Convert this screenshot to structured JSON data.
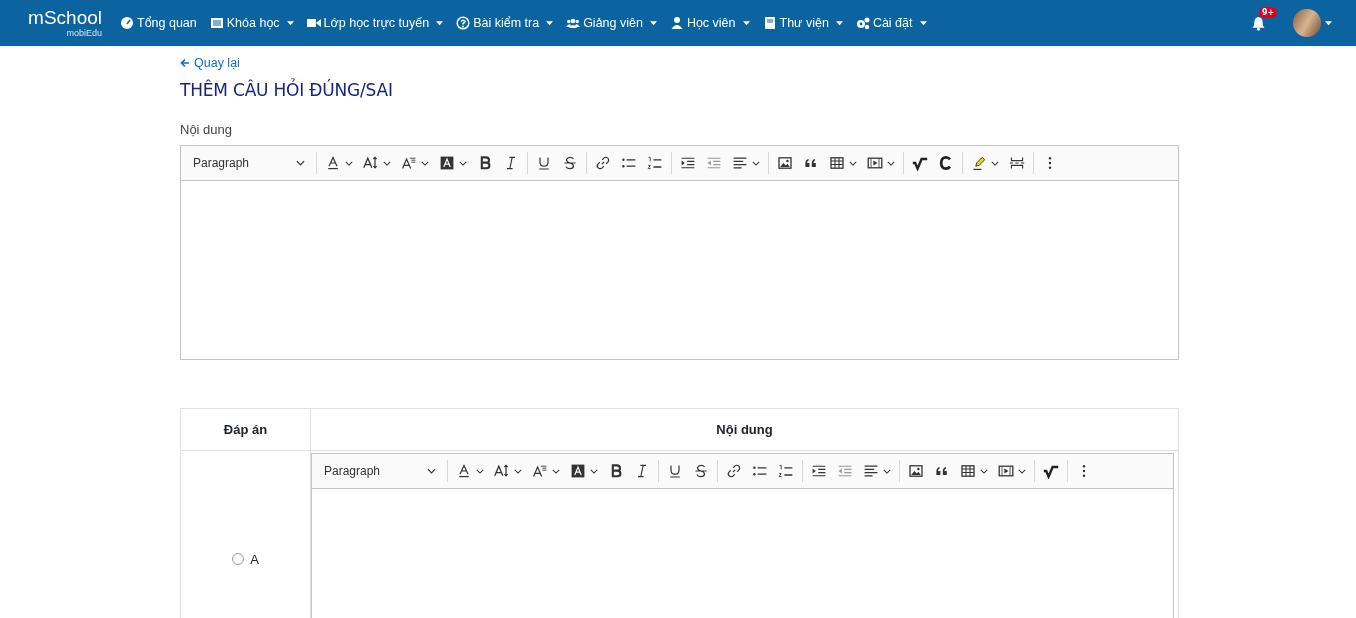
{
  "navbar": {
    "logo": {
      "main": "mSchool",
      "sub": "mobiEdu"
    },
    "items": [
      {
        "label": "Tổng quan",
        "dropdown": false
      },
      {
        "label": "Khóa học",
        "dropdown": true
      },
      {
        "label": "Lớp học trực tuyến",
        "dropdown": true
      },
      {
        "label": "Bài kiểm tra",
        "dropdown": true
      },
      {
        "label": "Giảng viên",
        "dropdown": true
      },
      {
        "label": "Học viên",
        "dropdown": true
      },
      {
        "label": "Thư viện",
        "dropdown": true
      },
      {
        "label": "Cài đặt",
        "dropdown": true
      }
    ],
    "notifications": {
      "badge": "9+"
    }
  },
  "back_link": "Quay lại",
  "title": "THÊM CÂU HỎI ĐÚNG/SAI",
  "content_label": "Nội dung",
  "editor": {
    "paragraph": "Paragraph"
  },
  "answers": {
    "columns": [
      "Đáp án",
      "Nội dung"
    ],
    "rows": [
      {
        "label": "A",
        "selected": false,
        "editor": {
          "paragraph": "Paragraph"
        }
      }
    ]
  }
}
